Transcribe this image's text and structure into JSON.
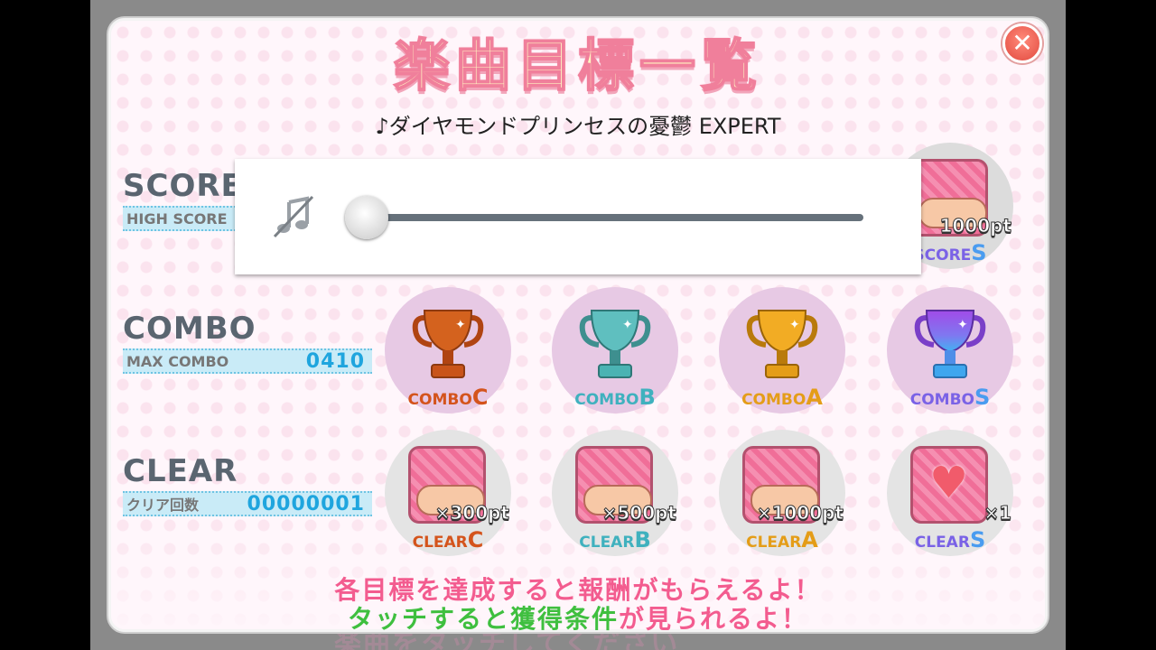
{
  "title": "楽曲目標一覧",
  "subtitle": "♪ダイヤモンドプリンセスの憂鬱 EXPERT",
  "background_text": "楽曲をタッチしてください",
  "score": {
    "label": "SCORE",
    "sub_label": "HIGH SCORE",
    "goal_s": {
      "reward": "1000pt",
      "label_prefix": "SCORE",
      "grade": "S"
    }
  },
  "combo": {
    "label": "COMBO",
    "sub_label": "MAX COMBO",
    "value": "0410",
    "goals": [
      {
        "prefix": "COMBO",
        "grade": "C"
      },
      {
        "prefix": "COMBO",
        "grade": "B"
      },
      {
        "prefix": "COMBO",
        "grade": "A"
      },
      {
        "prefix": "COMBO",
        "grade": "S"
      }
    ]
  },
  "clear": {
    "label": "CLEAR",
    "sub_label": "クリア回数",
    "value": "00000001",
    "goals": [
      {
        "reward": "×300pt",
        "prefix": "CLEAR",
        "grade": "C"
      },
      {
        "reward": "×500pt",
        "prefix": "CLEAR",
        "grade": "B"
      },
      {
        "reward": "×1000pt",
        "prefix": "CLEAR",
        "grade": "A"
      },
      {
        "reward": "×1",
        "prefix": "CLEAR",
        "grade": "S"
      }
    ]
  },
  "footer": {
    "line1": "各目標を達成すると報酬がもらえるよ！",
    "line2_green": "タッチすると獲得条件",
    "line2_rest": "が見られるよ！"
  },
  "volume": {
    "level": 0.0,
    "icon": "music-muted-icon"
  },
  "close_icon": "close-icon",
  "colors": {
    "title_fill": "#fff5c2",
    "title_stroke": "#f07f9b",
    "accent_blue": "#1fa5de",
    "footer_pink": "#f35c8f",
    "footer_green": "#3fbf3f",
    "close_red": "#e24a3f",
    "trophy_c": "#c9541a",
    "trophy_b": "#4bb3b3",
    "trophy_a": "#e49d18",
    "trophy_s": "#8a58e8"
  }
}
